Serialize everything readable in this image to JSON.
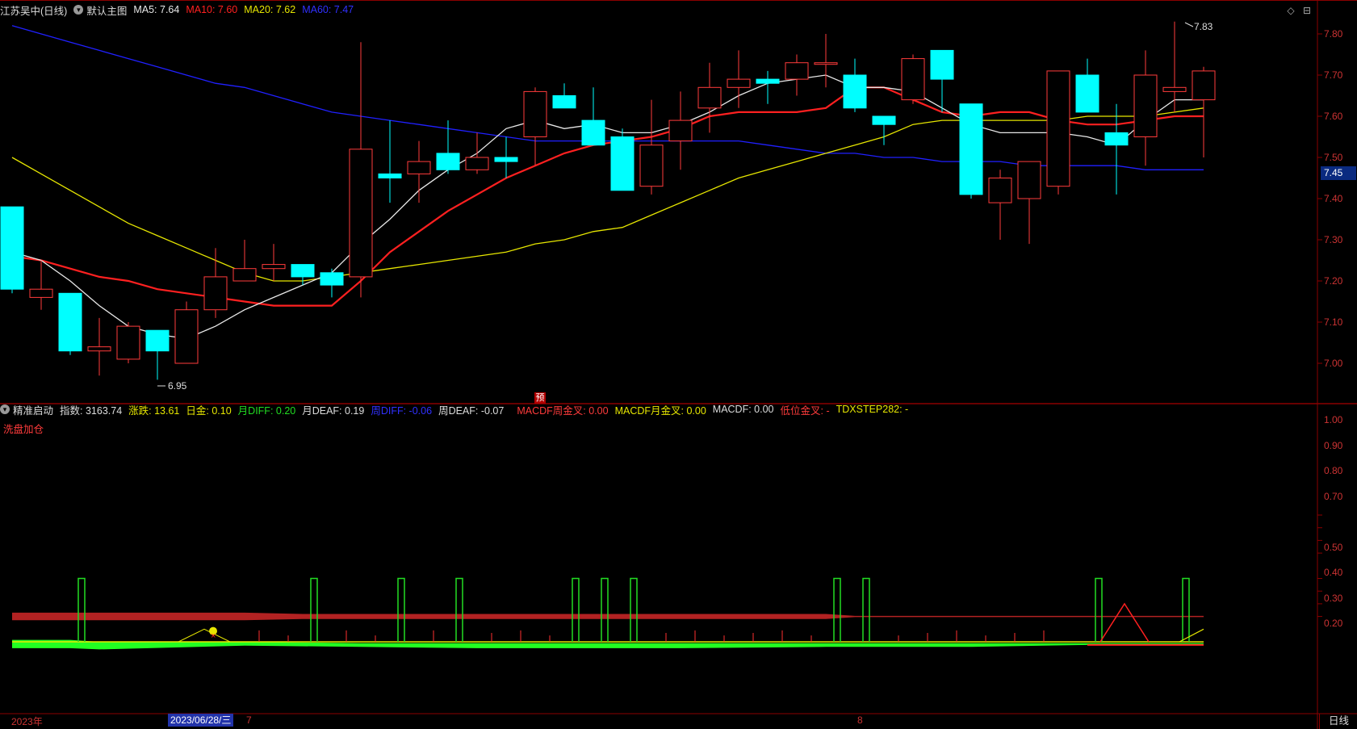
{
  "top_header": {
    "stock": "江苏吴中(日线)",
    "template": "默认主图",
    "ma5": "MA5: 7.64",
    "ma10": "MA10: 7.60",
    "ma20": "MA20: 7.62",
    "ma60": "MA60: 7.47"
  },
  "sub_header": {
    "indicator": "精准启动",
    "index": "指数: 3163.74",
    "change": "涨跌: 13.61",
    "day_gold": "日金: 0.10",
    "month_diff": "月DIFF: 0.20",
    "month_deaf": "月DEAF: 0.19",
    "week_diff": "周DIFF: -0.06",
    "week_deaf": "周DEAF: -0.07",
    "macdf_week_cross": "MACDF周金叉: 0.00",
    "macdf_month_cross": "MACDF月金叉: 0.00",
    "macdf": "MACDF: 0.00",
    "low_cross": "低位金叉: -",
    "tdxstep": "TDXSTEP282: -",
    "wash_label": "洗盘加仓"
  },
  "price_axis": [
    "7.80",
    "7.70",
    "7.60",
    "7.50",
    "7.40",
    "7.30",
    "7.20",
    "7.10",
    "7.00"
  ],
  "indicator_axis": [
    "1.00",
    "0.90",
    "0.80",
    "0.70",
    "0.50",
    "0.40",
    "0.30",
    "0.20"
  ],
  "current_price": "7.45",
  "high_label": "7.83",
  "low_label": "6.95",
  "forecast_label": "预",
  "date_axis": {
    "year": "2023年",
    "cursor_date": "2023/06/28/三",
    "month7": "7",
    "month8": "8"
  },
  "period_tab": "日线",
  "colors": {
    "up": "#ff3b3b",
    "down": "#00ffff",
    "ma5": "#e8e8e8",
    "ma10": "#ff2020",
    "ma20": "#e6e600",
    "ma60": "#2020ff",
    "axis": "#8b0000"
  },
  "candles": [
    {
      "o": 7.38,
      "h": 7.38,
      "c": 7.18,
      "l": 7.17
    },
    {
      "o": 7.16,
      "h": 7.25,
      "c": 7.18,
      "l": 7.13
    },
    {
      "o": 7.17,
      "h": 7.17,
      "c": 7.03,
      "l": 7.02
    },
    {
      "o": 7.03,
      "h": 7.11,
      "c": 7.04,
      "l": 6.97
    },
    {
      "o": 7.01,
      "h": 7.1,
      "c": 7.09,
      "l": 7.0
    },
    {
      "o": 7.08,
      "h": 7.08,
      "c": 7.03,
      "l": 6.96
    },
    {
      "o": 7.0,
      "h": 7.15,
      "c": 7.13,
      "l": 7.0
    },
    {
      "o": 7.13,
      "h": 7.28,
      "c": 7.21,
      "l": 7.11
    },
    {
      "o": 7.2,
      "h": 7.3,
      "c": 7.23,
      "l": 7.2
    },
    {
      "o": 7.23,
      "h": 7.29,
      "c": 7.24,
      "l": 7.2
    },
    {
      "o": 7.24,
      "h": 7.24,
      "c": 7.21,
      "l": 7.19
    },
    {
      "o": 7.22,
      "h": 7.23,
      "c": 7.19,
      "l": 7.16
    },
    {
      "o": 7.21,
      "h": 7.78,
      "c": 7.52,
      "l": 7.16
    },
    {
      "o": 7.46,
      "h": 7.59,
      "c": 7.45,
      "l": 7.39
    },
    {
      "o": 7.46,
      "h": 7.54,
      "c": 7.49,
      "l": 7.39
    },
    {
      "o": 7.51,
      "h": 7.59,
      "c": 7.47,
      "l": 7.46
    },
    {
      "o": 7.47,
      "h": 7.56,
      "c": 7.5,
      "l": 7.46
    },
    {
      "o": 7.5,
      "h": 7.55,
      "c": 7.49,
      "l": 7.45
    },
    {
      "o": 7.55,
      "h": 7.67,
      "c": 7.66,
      "l": 7.48
    },
    {
      "o": 7.65,
      "h": 7.68,
      "c": 7.62,
      "l": 7.62
    },
    {
      "o": 7.59,
      "h": 7.67,
      "c": 7.53,
      "l": 7.53
    },
    {
      "o": 7.55,
      "h": 7.57,
      "c": 7.42,
      "l": 7.42
    },
    {
      "o": 7.43,
      "h": 7.64,
      "c": 7.53,
      "l": 7.41
    },
    {
      "o": 7.54,
      "h": 7.66,
      "c": 7.59,
      "l": 7.47
    },
    {
      "o": 7.62,
      "h": 7.73,
      "c": 7.67,
      "l": 7.56
    },
    {
      "o": 7.67,
      "h": 7.76,
      "c": 7.69,
      "l": 7.62
    },
    {
      "o": 7.69,
      "h": 7.71,
      "c": 7.68,
      "l": 7.63
    },
    {
      "o": 7.69,
      "h": 7.75,
      "c": 7.73,
      "l": 7.65
    },
    {
      "o": 7.73,
      "h": 7.8,
      "c": 7.73,
      "l": 7.67
    },
    {
      "o": 7.7,
      "h": 7.74,
      "c": 7.62,
      "l": 7.61
    },
    {
      "o": 7.6,
      "h": 7.6,
      "c": 7.58,
      "l": 7.53
    },
    {
      "o": 7.64,
      "h": 7.75,
      "c": 7.74,
      "l": 7.63
    },
    {
      "o": 7.76,
      "h": 7.76,
      "c": 7.69,
      "l": 7.61
    },
    {
      "o": 7.63,
      "h": 7.63,
      "c": 7.41,
      "l": 7.4
    },
    {
      "o": 7.39,
      "h": 7.47,
      "c": 7.45,
      "l": 7.3
    },
    {
      "o": 7.4,
      "h": 7.49,
      "c": 7.49,
      "l": 7.29
    },
    {
      "o": 7.43,
      "h": 7.71,
      "c": 7.71,
      "l": 7.41
    },
    {
      "o": 7.7,
      "h": 7.74,
      "c": 7.61,
      "l": 7.61
    },
    {
      "o": 7.56,
      "h": 7.63,
      "c": 7.53,
      "l": 7.41
    },
    {
      "o": 7.55,
      "h": 7.76,
      "c": 7.7,
      "l": 7.48
    },
    {
      "o": 7.66,
      "h": 7.83,
      "c": 7.67,
      "l": 7.61
    },
    {
      "o": 7.64,
      "h": 7.72,
      "c": 7.71,
      "l": 7.5
    }
  ],
  "ma5_values": [
    7.27,
    7.25,
    7.2,
    7.14,
    7.09,
    7.07,
    7.06,
    7.09,
    7.13,
    7.16,
    7.19,
    7.22,
    7.29,
    7.35,
    7.42,
    7.47,
    7.51,
    7.57,
    7.59,
    7.57,
    7.58,
    7.56,
    7.56,
    7.58,
    7.61,
    7.65,
    7.68,
    7.69,
    7.7,
    7.67,
    7.67,
    7.66,
    7.62,
    7.58,
    7.56,
    7.56,
    7.56,
    7.55,
    7.53,
    7.59,
    7.64,
    7.64
  ],
  "ma10_values": [
    7.26,
    7.25,
    7.23,
    7.21,
    7.2,
    7.18,
    7.17,
    7.16,
    7.15,
    7.14,
    7.14,
    7.14,
    7.2,
    7.27,
    7.32,
    7.37,
    7.41,
    7.45,
    7.48,
    7.51,
    7.53,
    7.54,
    7.55,
    7.57,
    7.6,
    7.61,
    7.61,
    7.61,
    7.62,
    7.67,
    7.67,
    7.64,
    7.61,
    7.6,
    7.61,
    7.61,
    7.59,
    7.58,
    7.58,
    7.59,
    7.6,
    7.6
  ],
  "ma20_values": [
    7.5,
    7.46,
    7.42,
    7.38,
    7.34,
    7.31,
    7.28,
    7.25,
    7.22,
    7.2,
    7.2,
    7.21,
    7.22,
    7.23,
    7.24,
    7.25,
    7.26,
    7.27,
    7.29,
    7.3,
    7.32,
    7.33,
    7.36,
    7.39,
    7.42,
    7.45,
    7.47,
    7.49,
    7.51,
    7.53,
    7.55,
    7.58,
    7.59,
    7.59,
    7.59,
    7.59,
    7.59,
    7.6,
    7.6,
    7.6,
    7.61,
    7.62
  ],
  "ma60_values": [
    7.82,
    7.8,
    7.78,
    7.76,
    7.74,
    7.72,
    7.7,
    7.68,
    7.67,
    7.65,
    7.63,
    7.61,
    7.6,
    7.59,
    7.58,
    7.57,
    7.56,
    7.55,
    7.54,
    7.54,
    7.54,
    7.54,
    7.54,
    7.54,
    7.54,
    7.54,
    7.53,
    7.52,
    7.51,
    7.51,
    7.5,
    7.5,
    7.49,
    7.49,
    7.49,
    7.48,
    7.48,
    7.48,
    7.48,
    7.47,
    7.47,
    7.47
  ],
  "signal_bars": [
    2,
    10,
    13,
    15,
    19,
    20,
    21,
    28,
    29,
    37,
    40
  ],
  "triangle_peak": 38.5
}
